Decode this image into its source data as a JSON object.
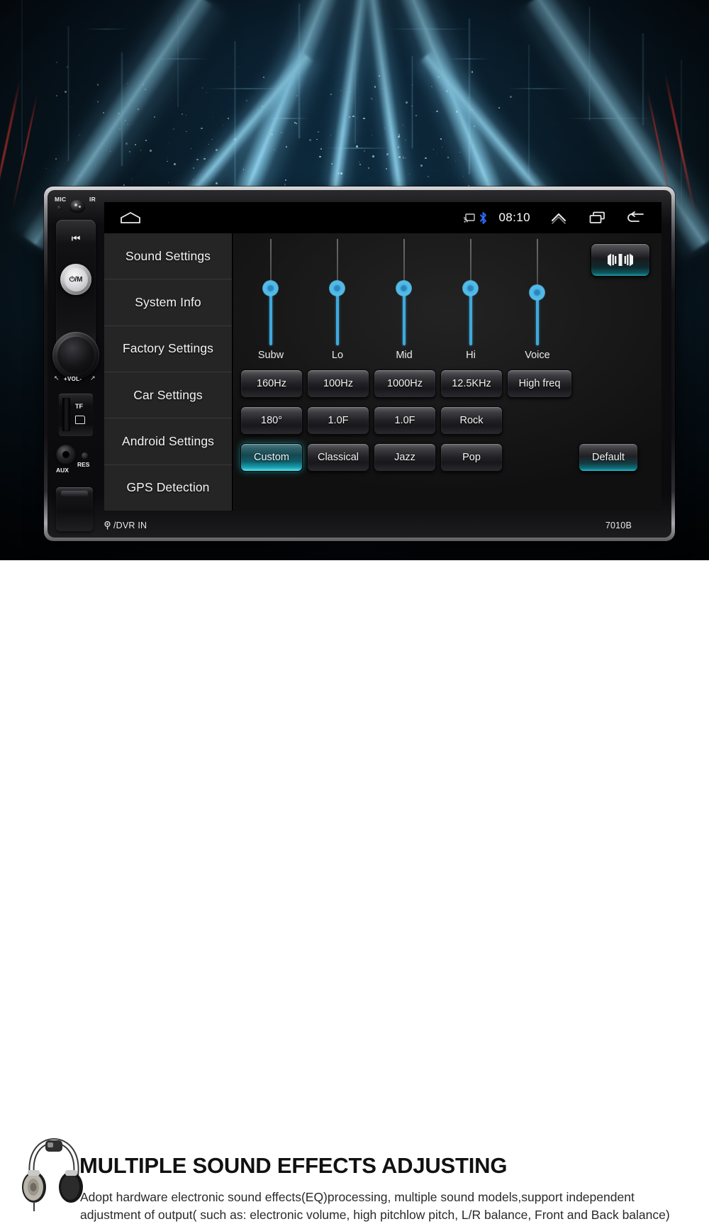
{
  "hero": {
    "scene_description": "dark blue concert stage with crossing light beams",
    "accent_blue": "#8fdcff",
    "accent_red": "#e24040"
  },
  "device": {
    "model_label": "7010B",
    "dvr_label": "/DVR IN",
    "left_controls": {
      "mic_label": "MIC",
      "ir_label": "IR",
      "prev_icon": "previous-track-icon",
      "next_icon": "next-track-icon",
      "power_label": "⏻/M",
      "vol_label": "+VOL-",
      "vol_left_arrow": "↖",
      "vol_right_arrow": "↗",
      "tf_label": "TF",
      "aux_label": "AUX",
      "res_label": "RES"
    }
  },
  "statusbar": {
    "home_icon": "home-icon",
    "cast_icon": "screen-cast-icon",
    "bluetooth_icon": "bluetooth-icon",
    "bluetooth_color": "#2b6cff",
    "time": "08:10",
    "chevron_icon": "chevron-up-icon",
    "recent_icon": "recent-apps-icon",
    "back_icon": "back-arrow-icon"
  },
  "sidebar": {
    "items": [
      {
        "label": "Sound Settings"
      },
      {
        "label": "System Info"
      },
      {
        "label": "Factory Settings"
      },
      {
        "label": "Car Settings"
      },
      {
        "label": "Android Settings"
      },
      {
        "label": "GPS Detection"
      }
    ]
  },
  "eq": {
    "balance_button": {
      "icon": "balance-fader-icon"
    },
    "sliders": [
      {
        "label": "Subw",
        "value": 54
      },
      {
        "label": "Lo",
        "value": 54
      },
      {
        "label": "Mid",
        "value": 54
      },
      {
        "label": "Hi",
        "value": 54
      },
      {
        "label": "Voice",
        "value": 50
      }
    ],
    "row1": [
      {
        "label": "160Hz",
        "selected": false
      },
      {
        "label": "100Hz",
        "selected": false
      },
      {
        "label": "1000Hz",
        "selected": false
      },
      {
        "label": "12.5KHz",
        "selected": false
      },
      {
        "label": "High freq",
        "selected": false
      }
    ],
    "row2": [
      {
        "label": "180°",
        "selected": false
      },
      {
        "label": "1.0F",
        "selected": false
      },
      {
        "label": "1.0F",
        "selected": false
      },
      {
        "label": "Rock",
        "selected": false
      }
    ],
    "row3": [
      {
        "label": "Custom",
        "selected": true
      },
      {
        "label": "Classical",
        "selected": false
      },
      {
        "label": "Jazz",
        "selected": false
      },
      {
        "label": "Pop",
        "selected": false
      }
    ],
    "default_button": {
      "label": "Default"
    }
  },
  "promo": {
    "icon": "headphones-icon",
    "title": "MULTIPLE SOUND EFFECTS ADJUSTING",
    "body": "Adopt hardware electronic sound effects(EQ)processing, multiple sound models,support independent adjustment of output( such as: electronic volume, high pitchlow pitch, L/R balance, Front and Back balance)"
  }
}
